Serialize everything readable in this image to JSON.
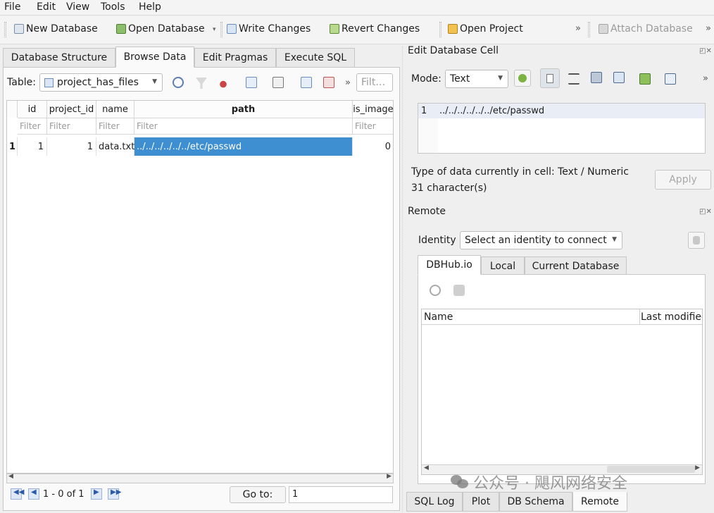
{
  "menu": {
    "file": "File",
    "edit": "Edit",
    "view": "View",
    "tools": "Tools",
    "help": "Help"
  },
  "toolbar": {
    "new_database": "New Database",
    "open_database": "Open Database",
    "write_changes": "Write Changes",
    "revert_changes": "Revert Changes",
    "open_project": "Open Project",
    "overflow": "»",
    "attach_database": "Attach Database",
    "overflow2": "»"
  },
  "left_tabs": [
    "Database Structure",
    "Browse Data",
    "Edit Pragmas",
    "Execute SQL"
  ],
  "browse": {
    "table_label": "Table:",
    "table_value": "project_has_files",
    "overflow": "»",
    "filter_placeholder": "Filt…",
    "columns": [
      "id",
      "project_id",
      "name",
      "path",
      "is_image"
    ],
    "filter_text": [
      "Filter",
      "Filter",
      "Filter",
      "Filter",
      "Filter"
    ],
    "rows": [
      {
        "rownum": "1",
        "id": "1",
        "project_id": "1",
        "name": "data.txt",
        "path": "../../../../../../etc/passwd",
        "is_image": "0"
      }
    ],
    "nav": {
      "first": "⏮",
      "prev": "◀",
      "range": "1 - 0 of 1",
      "next": "▶",
      "last": "⏭",
      "goto_label": "Go to:",
      "goto_value": "1"
    }
  },
  "edit_cell": {
    "title": "Edit Database Cell",
    "mode_label": "Mode:",
    "mode_value": "Text",
    "overflow": "»",
    "line_number": "1",
    "cell_value": "../../../../../../etc/passwd",
    "type_info": "Type of data currently in cell: Text / Numeric",
    "char_count": "31 character(s)",
    "apply_label": "Apply"
  },
  "remote": {
    "title": "Remote",
    "identity_label": "Identity",
    "identity_value": "Select an identity to connect",
    "tabs": [
      "DBHub.io",
      "Local",
      "Current Database"
    ],
    "columns": [
      "Name",
      "Last modified"
    ]
  },
  "dock_tabs": [
    "SQL Log",
    "Plot",
    "DB Schema",
    "Remote"
  ],
  "watermark": "公众号 · 飓风网络安全",
  "colors": {
    "selection": "#3d8fd1",
    "accent_blue": "#2b5ba8"
  }
}
